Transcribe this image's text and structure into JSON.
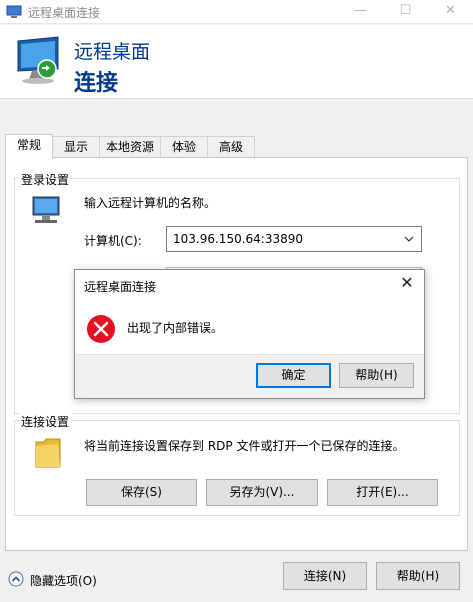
{
  "window": {
    "title": "远程桌面连接",
    "minimize": "—",
    "maximize": "☐",
    "close": "✕"
  },
  "banner": {
    "line1": "远程桌面",
    "line2": "连接"
  },
  "tabs": [
    "常规",
    "显示",
    "本地资源",
    "体验",
    "高级"
  ],
  "login_settings": {
    "group_label": "登录设置",
    "instruction": "输入远程计算机的名称。",
    "computer_label": "计算机(C):",
    "computer_value": "103.96.150.64:33890"
  },
  "connection_settings": {
    "group_label": "连接设置",
    "description": "将当前连接设置保存到 RDP 文件或打开一个已保存的连接。",
    "save_button": "保存(S)",
    "save_as_button": "另存为(V)...",
    "open_button": "打开(E)..."
  },
  "footer": {
    "hide_options": "隐藏选项(O)",
    "connect_button": "连接(N)",
    "help_button": "帮助(H)"
  },
  "error_dialog": {
    "title": "远程桌面连接",
    "close": "✕",
    "message": "出现了内部错误。",
    "ok_button": "确定",
    "help_button": "帮助(H)"
  },
  "colors": {
    "accent": "#0078d7",
    "banner_text": "#003a8c",
    "error_red": "#e81123"
  },
  "icons": [
    "remote-desktop-icon",
    "computer-icon",
    "folder-icon",
    "error-icon",
    "chevron-up-icon",
    "dropdown-caret-icon"
  ]
}
